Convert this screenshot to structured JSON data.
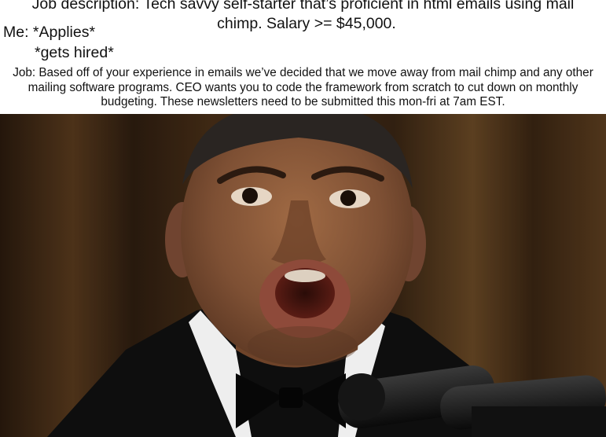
{
  "caption": {
    "job_description_line1": "Job description: Tech savvy self-starter that’s proficient in html emails using mail",
    "job_description_line2": "chimp. Salary >= $45,000.",
    "me_applies": "Me: *Applies*",
    "gets_hired": "*gets hired*",
    "job_reply": "Job: Based off of your experience in emails we’ve decided that we move away from mail chimp and any other mailing software programs. CEO wants you to code the framework from scratch to cut down on monthly budgeting. These newsletters need to be submitted this mon-fri at 7am EST."
  },
  "colors": {
    "background": "#ffffff",
    "text": "#111111",
    "curtain_dark": "#2a1a0d",
    "curtain_light": "#6b4a26",
    "skin": "#8a5a3a",
    "suit": "#111111",
    "shirt": "#f2f2f2"
  }
}
